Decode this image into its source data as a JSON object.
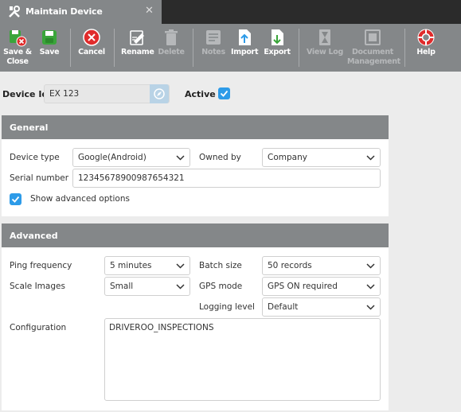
{
  "window": {
    "title": "Maintain Device",
    "close_glyph": "✕"
  },
  "toolbar": {
    "save_close": "Save & Close",
    "save": "Save",
    "cancel": "Cancel",
    "rename": "Rename",
    "delete": "Delete",
    "notes": "Notes",
    "import": "Import",
    "export": "Export",
    "view_log": "View Log",
    "document_management": "Document Management",
    "help": "Help"
  },
  "device": {
    "id_label": "Device Id",
    "id_value": "EX 123",
    "active_label": "Active",
    "active_checked": true
  },
  "general": {
    "title": "General",
    "device_type_label": "Device type",
    "device_type_value": "Google(Android)",
    "owned_by_label": "Owned by",
    "owned_by_value": "Company",
    "serial_label": "Serial number",
    "serial_value": "12345678900987654321",
    "advanced_options_label": "Show advanced options",
    "advanced_options_checked": true
  },
  "advanced": {
    "title": "Advanced",
    "ping_label": "Ping frequency",
    "ping_value": "5 minutes",
    "batch_label": "Batch size",
    "batch_value": "50 records",
    "scale_label": "Scale Images",
    "scale_value": "Small",
    "gps_label": "GPS mode",
    "gps_value": "GPS ON required",
    "logging_label": "Logging level",
    "logging_value": "Default",
    "config_label": "Configuration",
    "config_value": "DRIVEROO_INSPECTIONS"
  },
  "colors": {
    "toolbar": "#848789",
    "titlebar": "#2b2b2b",
    "accent": "#2d9be8",
    "danger": "#e02b2b",
    "save_green": "#3aa53a"
  }
}
